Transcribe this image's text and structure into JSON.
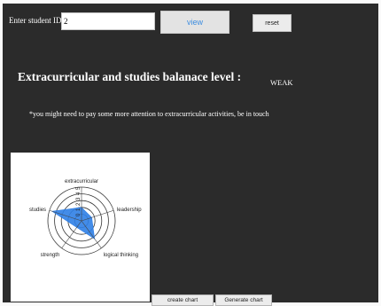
{
  "form": {
    "id_label": "Enter student ID",
    "id_value": "2",
    "view_label": "view",
    "reset_label": "reset"
  },
  "result": {
    "balance_title": "Extracurricular and studies balanace level :",
    "balance_level": "WEAK",
    "advice": "*you might need to pay some more attention to extracurricular activities, be in touch"
  },
  "buttons": {
    "create_chart": "create chart",
    "generate_chart": "Generate chart"
  },
  "colors": {
    "background": "#2b2b2b",
    "accent": "#3d8de0",
    "chart_fill": "#2f7fe6"
  },
  "chart_data": {
    "type": "radar",
    "axes": [
      "extracurricular",
      "leadership",
      "logical thinking",
      "strength",
      "studies"
    ],
    "scale_labels": [
      "5",
      "4",
      "3",
      "2",
      "1",
      "0"
    ],
    "rmax": 5,
    "rings": 5,
    "values": [
      2,
      1.6,
      3.3,
      1.2,
      4.6
    ]
  }
}
